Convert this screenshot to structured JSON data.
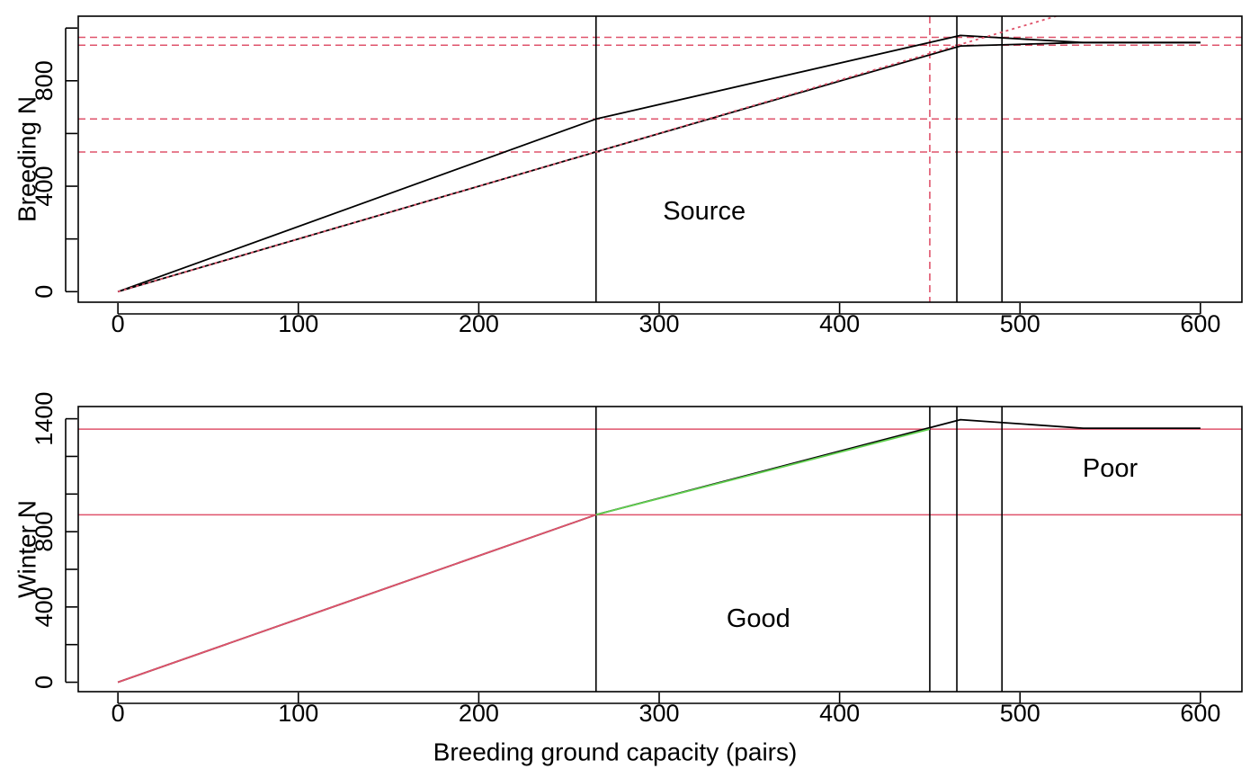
{
  "colors": {
    "black": "#000000",
    "red": "#DF536B",
    "green": "#61D04F"
  },
  "chart_data": [
    {
      "type": "line",
      "ylabel": "Breeding N",
      "xlabel": "",
      "xlim": [
        -22,
        623
      ],
      "ylim": [
        -40,
        1045
      ],
      "x_ticks": [
        0,
        100,
        200,
        300,
        400,
        500,
        600
      ],
      "x_tick_labels": [
        "0",
        "100",
        "200",
        "300",
        "400",
        "500",
        "600"
      ],
      "y_ticks": [
        0,
        200,
        400,
        600,
        800,
        1000
      ],
      "y_tick_labels": [
        "0",
        "",
        "400",
        "",
        "800",
        ""
      ],
      "annotations": [
        {
          "text": "Source",
          "x": 325,
          "y": 300
        }
      ],
      "vlines": [
        {
          "x": 265,
          "color": "black",
          "dash": false
        },
        {
          "x": 450,
          "color": "red",
          "dash": true
        },
        {
          "x": 465,
          "color": "black",
          "dash": false
        },
        {
          "x": 490,
          "color": "black",
          "dash": false
        }
      ],
      "hlines": [
        {
          "y": 530,
          "color": "red",
          "dash": true
        },
        {
          "y": 655,
          "color": "red",
          "dash": true
        },
        {
          "y": 935,
          "color": "red",
          "dash": true
        },
        {
          "y": 965,
          "color": "red",
          "dash": true
        }
      ],
      "series": [
        {
          "color": "black",
          "dash": false,
          "x": [
            0,
            265,
            467,
            535,
            600
          ],
          "y": [
            0,
            655,
            972,
            945,
            945
          ]
        },
        {
          "color": "black",
          "dash": false,
          "x": [
            0,
            265,
            467,
            535,
            600
          ],
          "y": [
            0,
            530,
            932,
            945,
            945
          ]
        },
        {
          "color": "red",
          "dash": true,
          "x": [
            0,
            265,
            520
          ],
          "y": [
            0,
            530,
            1045
          ]
        }
      ]
    },
    {
      "type": "line",
      "ylabel": "Winter N",
      "xlabel": "Breeding ground capacity (pairs)",
      "xlim": [
        -22,
        623
      ],
      "ylim": [
        -50,
        1465
      ],
      "x_ticks": [
        0,
        100,
        200,
        300,
        400,
        500,
        600
      ],
      "x_tick_labels": [
        "0",
        "100",
        "200",
        "300",
        "400",
        "500",
        "600"
      ],
      "y_ticks": [
        0,
        200,
        400,
        600,
        800,
        1000,
        1200,
        1400
      ],
      "y_tick_labels": [
        "0",
        "",
        "400",
        "",
        "800",
        "",
        "",
        "1400"
      ],
      "annotations": [
        {
          "text": "Good",
          "x": 355,
          "y": 330
        },
        {
          "text": "Poor",
          "x": 550,
          "y": 1130
        }
      ],
      "vlines": [
        {
          "x": 265,
          "color": "black",
          "dash": false
        },
        {
          "x": 450,
          "color": "black",
          "dash": false
        },
        {
          "x": 465,
          "color": "black",
          "dash": false
        },
        {
          "x": 490,
          "color": "black",
          "dash": false
        }
      ],
      "hlines": [
        {
          "y": 890,
          "color": "red",
          "dash": false
        },
        {
          "y": 1345,
          "color": "red",
          "dash": false
        }
      ],
      "series": [
        {
          "color": "black",
          "dash": false,
          "x": [
            0,
            265,
            467,
            535,
            600
          ],
          "y": [
            0,
            890,
            1395,
            1350,
            1350
          ]
        },
        {
          "color": "red",
          "dash": false,
          "x": [
            0,
            265
          ],
          "y": [
            0,
            890
          ]
        },
        {
          "color": "green",
          "dash": false,
          "x": [
            265,
            450
          ],
          "y": [
            890,
            1345
          ]
        }
      ]
    }
  ]
}
